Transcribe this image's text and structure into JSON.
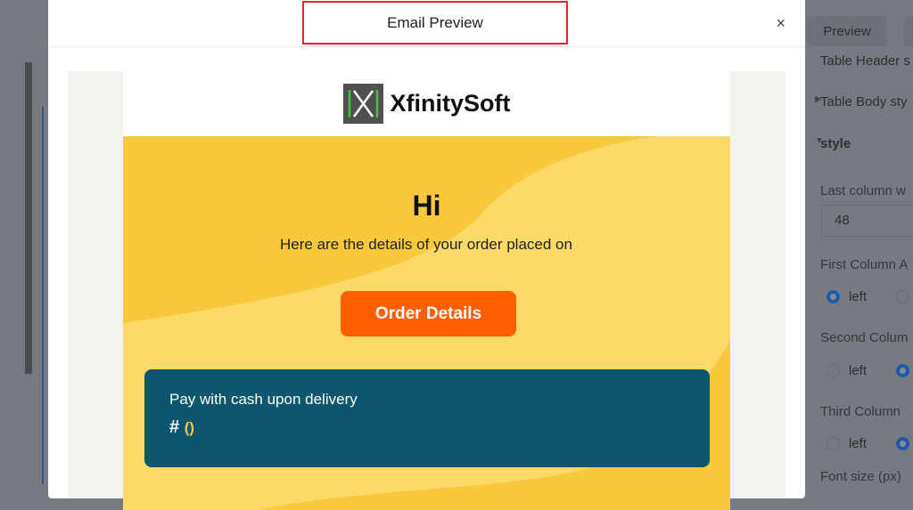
{
  "modal": {
    "title": "Email Preview",
    "close_label": "×"
  },
  "email": {
    "brand": "XfinitySoft",
    "greeting": "Hi",
    "intro": "Here are the details of your order placed on",
    "order_button": "Order Details",
    "payment_method": "Pay with cash upon delivery",
    "order_hash": "#",
    "order_paren": "()"
  },
  "background_app": {
    "preview_button": "Preview",
    "panel": {
      "table_header": "Table Header s",
      "table_body": "Table Body sty",
      "style_section": "style",
      "last_column_label": "Last column w",
      "last_column_value": "48",
      "first_column_label": "First Column A",
      "second_column_label": "Second Colum",
      "third_column_label": "Third Column",
      "left_option": "left",
      "font_size_label": "Font size (px)"
    }
  },
  "colors": {
    "accent": "#ff5f00",
    "card": "#0d5670",
    "yellow_dark": "#f8c93a",
    "yellow_light": "#fdd96a",
    "highlight": "#e3232b"
  }
}
